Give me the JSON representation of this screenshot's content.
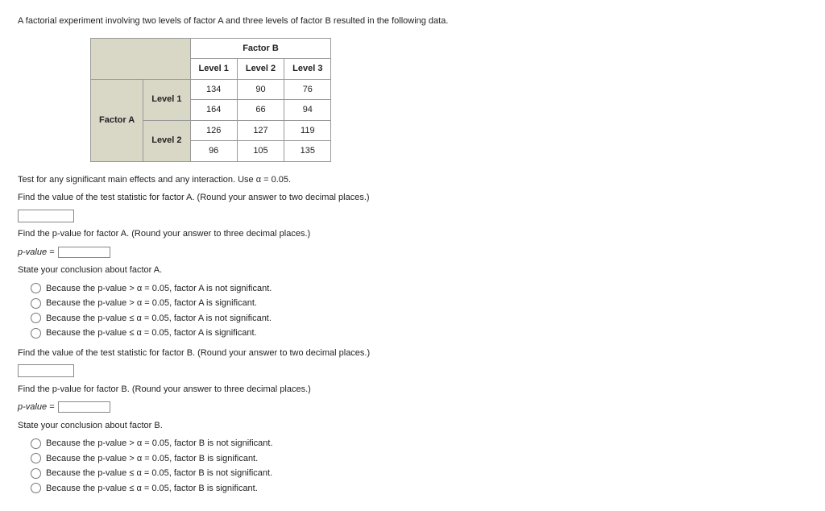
{
  "intro": "A factorial experiment involving two levels of factor A and three levels of factor B resulted in the following data.",
  "table": {
    "factorB_label": "Factor B",
    "factorA_label": "Factor A",
    "colHeads": [
      "Level 1",
      "Level 2",
      "Level 3"
    ],
    "rowHeads": [
      "Level 1",
      "Level 2"
    ],
    "data": [
      [
        "134",
        "90",
        "76"
      ],
      [
        "164",
        "66",
        "94"
      ],
      [
        "126",
        "127",
        "119"
      ],
      [
        "96",
        "105",
        "135"
      ]
    ]
  },
  "q1": "Test for any significant main effects and any interaction. Use α = 0.05.",
  "q2": "Find the value of the test statistic for factor A. (Round your answer to two decimal places.)",
  "q3": "Find the p-value for factor A. (Round your answer to three decimal places.)",
  "pvalue_label": "p-value =",
  "concA_title": "State your conclusion about factor A.",
  "concA_opts": [
    "Because the p-value > α = 0.05, factor A is not significant.",
    "Because the p-value > α = 0.05, factor A is significant.",
    "Because the p-value ≤ α = 0.05, factor A is not significant.",
    "Because the p-value ≤ α = 0.05, factor A is significant."
  ],
  "q4": "Find the value of the test statistic for factor B. (Round your answer to two decimal places.)",
  "q5": "Find the p-value for factor B. (Round your answer to three decimal places.)",
  "concB_title": "State your conclusion about factor B.",
  "concB_opts": [
    "Because the p-value > α = 0.05, factor B is not significant.",
    "Because the p-value > α = 0.05, factor B is significant.",
    "Because the p-value ≤ α = 0.05, factor B is not significant.",
    "Because the p-value ≤ α = 0.05, factor B is significant."
  ]
}
